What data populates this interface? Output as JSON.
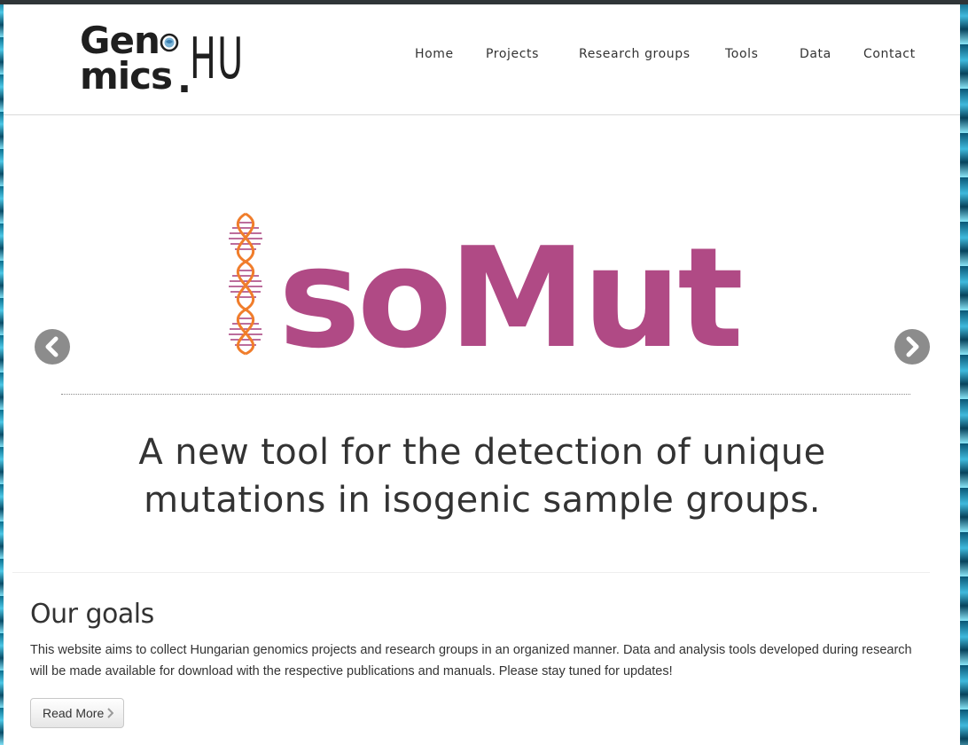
{
  "logo": {
    "line1": "Gen",
    "line2": "mics",
    "dot": ".",
    "suffix": "HU"
  },
  "nav": {
    "items": [
      {
        "label": "Home"
      },
      {
        "label": "Projects"
      },
      {
        "label": "Research groups"
      },
      {
        "label": "Tools"
      },
      {
        "label": "Data"
      },
      {
        "label": "Contact"
      }
    ]
  },
  "slider": {
    "brand": "soMut",
    "tagline_line1": "A new tool for the detection of unique",
    "tagline_line2": "mutations in isogenic sample groups.",
    "prev_icon": "chevron-left-icon",
    "next_icon": "chevron-right-icon"
  },
  "goals": {
    "title": "Our goals",
    "text": "This website aims to collect Hungarian genomics projects and research groups in an organized manner. Data and analysis tools developed during research will be made available for download with the respective publications and manuals. Please stay tuned for updates!",
    "button_label": "Read More"
  },
  "colors": {
    "brand": "#b04a85",
    "dna_outline": "#f07d2b",
    "dna_rungs": "#a63d7c",
    "arrow_bg": "#8c8c8c",
    "topbar": "#2f3538"
  }
}
